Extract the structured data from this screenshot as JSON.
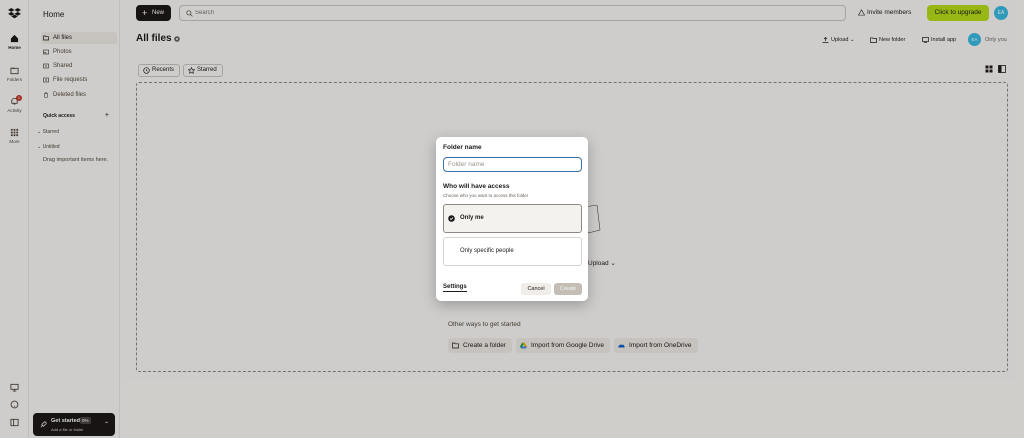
{
  "rail": {
    "items": [
      {
        "label": "Home",
        "icon": "home-icon"
      },
      {
        "label": "Folders",
        "icon": "folders-icon"
      },
      {
        "label": "Activity",
        "icon": "bell-icon",
        "badge": "1"
      },
      {
        "label": "More",
        "icon": "grid-icon"
      }
    ]
  },
  "sidenav": {
    "title": "Home",
    "items": [
      {
        "label": "All files",
        "icon": "folder-icon",
        "active": true
      },
      {
        "label": "Photos",
        "icon": "photo-icon"
      },
      {
        "label": "Shared",
        "icon": "shared-icon"
      },
      {
        "label": "File requests",
        "icon": "file-request-icon"
      },
      {
        "label": "Deleted files",
        "icon": "trash-icon"
      }
    ],
    "quick_access": "Quick access",
    "groups": [
      "Starred",
      "Untitled"
    ],
    "hint": "Drag important items here."
  },
  "get_started": {
    "title": "Get started",
    "percent": "0%",
    "subtitle": "Add a file or folder"
  },
  "topbar": {
    "new_label": "New",
    "search_placeholder": "Search",
    "invite_label": "Invite members",
    "upgrade_label": "Click to upgrade",
    "avatar_initials": "EA"
  },
  "page": {
    "title": "All files",
    "toolbar": {
      "upload": "Upload",
      "new_folder": "New folder",
      "install_app": "Install app",
      "only_you": "Only you",
      "avatar_initials": "EA"
    },
    "chips": [
      "Recents",
      "Starred"
    ]
  },
  "dropzone": {
    "upload_peek": "Upload",
    "other_ways": "Other ways to get started",
    "actions": [
      "Create a folder",
      "Import from Google Drive",
      "Import from OneDrive"
    ]
  },
  "modal": {
    "folder_name_label": "Folder name",
    "folder_name_placeholder": "Folder name",
    "access_heading": "Who will have access",
    "access_sub": "Choose who you want to access this folder",
    "options": [
      "Only me",
      "Only specific people"
    ],
    "settings": "Settings",
    "cancel": "Cancel",
    "create": "Create"
  },
  "colors": {
    "upgrade": "#b4dc19",
    "avatar": "#38b8e0",
    "dark": "#1e1919",
    "input_focus": "#3b6ea5"
  }
}
